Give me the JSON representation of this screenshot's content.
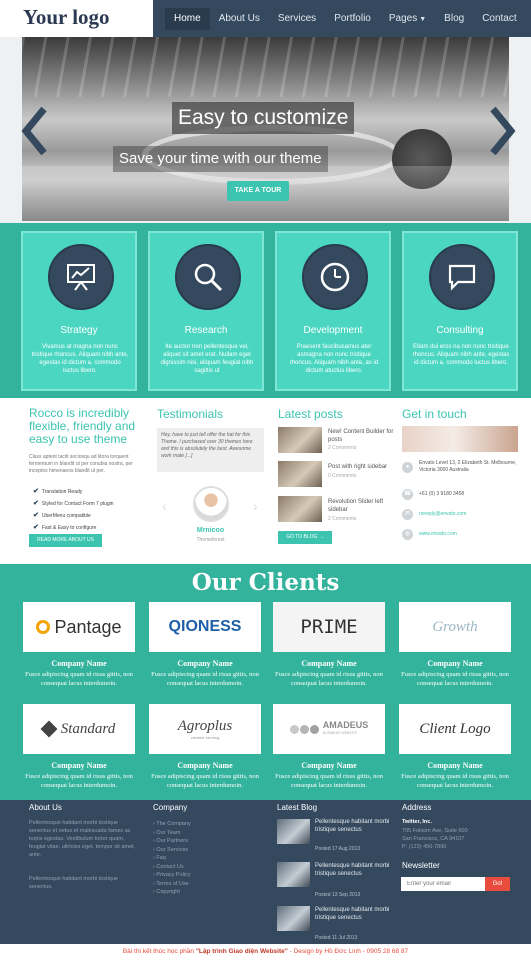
{
  "header": {
    "logo": "Your logo",
    "nav": [
      "Home",
      "About Us",
      "Services",
      "Portfolio",
      "Pages",
      "Blog",
      "Contact"
    ]
  },
  "hero": {
    "title": "Easy to customize",
    "subtitle": "Save your time with our theme",
    "button": "TAKE A TOUR",
    "prev_icon": "chevron-left-icon",
    "next_icon": "chevron-right-icon"
  },
  "services": [
    {
      "title": "Strategy",
      "icon": "presentation-chart-icon",
      "desc": "Vivamus at magna non nunc tristique rhoncus. Aliquam nibh ante, egestas id dictum a, commodo luctus libero."
    },
    {
      "title": "Research",
      "icon": "search-icon",
      "desc": "Ite auctor non pellentesque vel, aliquet sit amet erat. Nullam eget dignissim nisi, aliquam feugiat nibh sagittis ut"
    },
    {
      "title": "Development",
      "icon": "clock-icon",
      "desc": "Praesent faucibusamus ater asmagna non nunc tristique rhoncus. Aliquam nibh ante, as id dictum atuctus libero."
    },
    {
      "title": "Consulting",
      "icon": "speech-bubble-icon",
      "desc": "Etiam dui eros na non nunc tristique rhoncus. Aliquam nibh ante, egestas id dictum a, commodo luctus libero."
    }
  ],
  "about": {
    "heading": "Rocco is incredibly flexible, friendly and easy to use theme",
    "text": "Class aptent taciti sociosqu ad litora torquent fermentum in blandit ut per conubia nostra, per inceptos himenaeos blandit ut per.",
    "features": [
      "Translation Ready",
      "Styled for Contact Form 7 plugin",
      "UberMenu compatible",
      "Fast & Easy to configure"
    ],
    "button": "READ MORE ABOUT US"
  },
  "testimonials": {
    "heading": "Testimonials",
    "quote": "Hey, have to just tell offer the hat for this Theme. I purchased over 30 themes here and this is absolutely the best. Awesome work mate [...]",
    "name": "Mrnicoo",
    "company": "Themeforest"
  },
  "posts": {
    "heading": "Latest posts",
    "items": [
      {
        "title": "New! Content Builder for posts",
        "meta": "2 Comments"
      },
      {
        "title": "Post with right sidebar",
        "meta": "0 Comments"
      },
      {
        "title": "Revolution Slider left sidebar",
        "meta": "2 Comments"
      }
    ],
    "button": "GO TO BLOG →"
  },
  "touch": {
    "heading": "Get in touch",
    "address": "Envato Level 13, 2 Elizabeth St. Melbourne, Victoria 3000 Australia",
    "phone": "+61 (0) 3 9180 3458",
    "email": "noreply@envato.com",
    "web": "www.envato.com"
  },
  "clients": {
    "title": "Our Clients",
    "items": [
      {
        "logo": "Pantage",
        "name": "Company Name",
        "desc": "Fusce adipiscing quam id risus gittis, non consequat lacus interdumoin."
      },
      {
        "logo": "QIONESS",
        "name": "Company Name",
        "desc": "Fusce adipiscing quam id risus gittis, non consequat lacus interdumoin."
      },
      {
        "logo": "PRIME",
        "name": "Company Name",
        "desc": "Fusce adipiscing quam id risus gittis, non consequat lacus interdumoin."
      },
      {
        "logo": "Growth",
        "name": "Company Name",
        "desc": "Fusce adipiscing quam id risus gittis, non consequat lacus interdumoin."
      },
      {
        "logo": "Standard",
        "name": "Company Name",
        "desc": "Fusce adipiscing quam id risus gittis, non consequat lacus interdumoin."
      },
      {
        "logo": "Agroplus",
        "logo_sub": "creative farming",
        "name": "Company Name",
        "desc": "Fusce adipiscing quam id risus gittis, non consequat lacus interdumoin."
      },
      {
        "logo": "AMADEUS",
        "logo_sub": "BUSINESS WEBSITE",
        "name": "Company Name",
        "desc": "Fusce adipiscing quam id risus gittis, non consequat lacus interdumoin."
      },
      {
        "logo": "Client Logo",
        "name": "Company Name",
        "desc": "Fusce adipiscing quam id risus gittis, non consequat lacus interdumoin."
      }
    ]
  },
  "footer": {
    "about_h": "About Us",
    "about_p1": "Pellentesque habitant morbi tristique senectus et netus et malesuada fames ac turpis egestas. Vestibulum tortor quam, feugiat vitae, ultricies eget, tempor sit amet, ante.",
    "about_p2": "Pellentesque habitant morbi tristique senectus.",
    "company_h": "Company",
    "company": [
      "› The Company",
      "› Our Team",
      "› Our Partners",
      "› Our Services",
      "› Faq",
      "› Contact Us",
      "› Privacy Policy",
      "› Terms of Use",
      "› Copyright"
    ],
    "blog_h": "Latest Blog",
    "blog": [
      {
        "title": "Pellentesque habitant morbi tristique senectus",
        "date": "Posted 17 Aug 2013"
      },
      {
        "title": "Pellentesque habitant morbi tristique senectus",
        "date": "Posted 13 Sep 2013"
      },
      {
        "title": "Pellentesque habitant morbi tristique senectus",
        "date": "Posted 11 Jul 2013"
      }
    ],
    "address_h": "Address",
    "address_name": "Twitter, Inc.",
    "address": [
      "795 Folsom Ave, Suite 600",
      "San Francisco, CA 94107",
      "P: (123) 456-7890"
    ],
    "newsletter_h": "Newsletter",
    "newsletter_placeholder": "Enter your email",
    "newsletter_btn": "Go!"
  },
  "bottom": {
    "prefix": "Bài thi kết thúc học phần ",
    "course": "\"Lập trình Giao diện Website\"",
    "suffix": " - Design by Hồ Đức Linh - 0905 28 68 87"
  }
}
